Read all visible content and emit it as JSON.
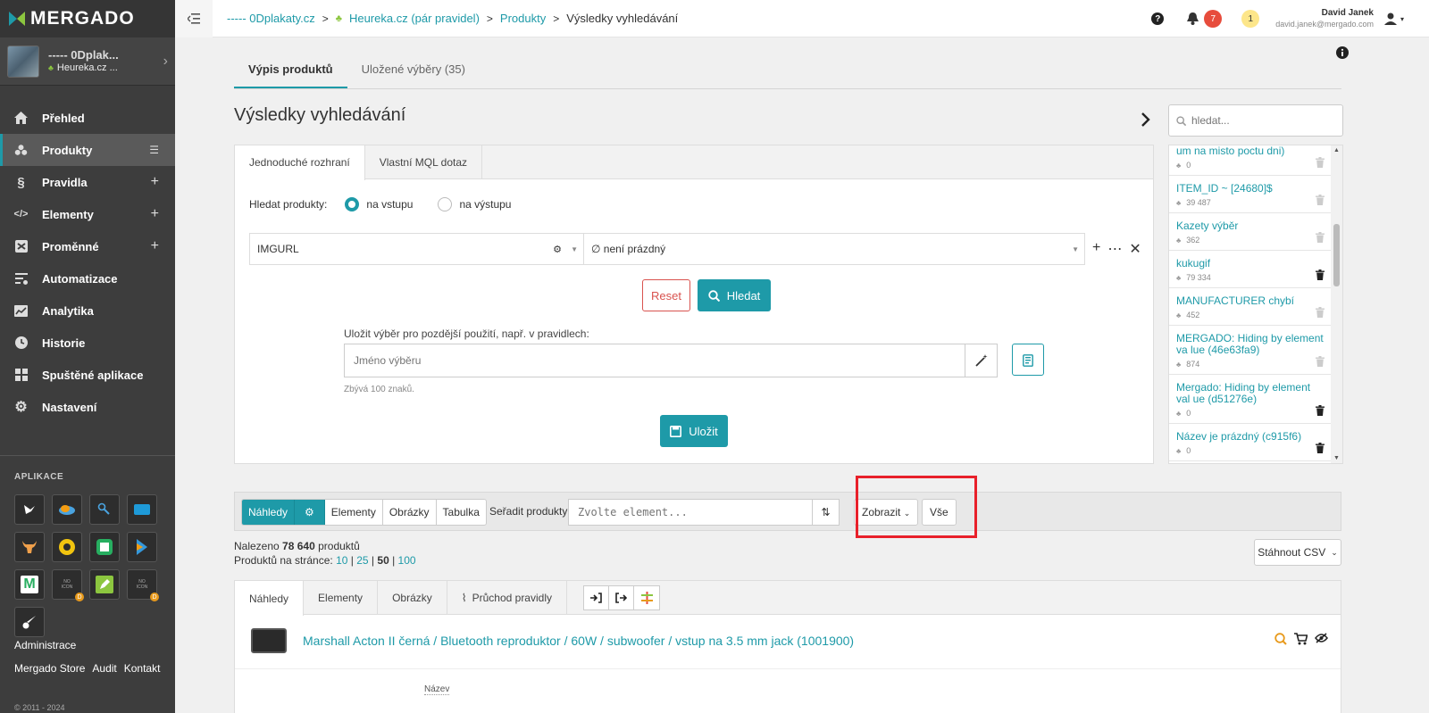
{
  "brand": {
    "name": "MERGADO"
  },
  "project": {
    "name": "----- 0Dplak...",
    "channel": "Heureka.cz ..."
  },
  "nav": [
    {
      "label": "Přehled",
      "icon": "home-icon",
      "right": ""
    },
    {
      "label": "Produkty",
      "icon": "products-icon",
      "right": "list",
      "active": true
    },
    {
      "label": "Pravidla",
      "icon": "section-icon",
      "right": "+"
    },
    {
      "label": "Elementy",
      "icon": "code-icon",
      "right": "+"
    },
    {
      "label": "Proměnné",
      "icon": "variable-icon",
      "right": "+"
    },
    {
      "label": "Automatizace",
      "icon": "automation-icon",
      "right": ""
    },
    {
      "label": "Analytika",
      "icon": "chart-icon",
      "right": ""
    },
    {
      "label": "Historie",
      "icon": "history-icon",
      "right": ""
    },
    {
      "label": "Spuštěné aplikace",
      "icon": "apps-grid-icon",
      "right": ""
    },
    {
      "label": "Nastavení",
      "icon": "gear-icon",
      "right": ""
    }
  ],
  "apps_title": "APLIKACE",
  "side_footer": {
    "admin": "Administrace",
    "store": "Mergado Store",
    "audit": "Audit",
    "contact": "Kontakt",
    "copyright": "© 2011 - 2024"
  },
  "breadcrumb": {
    "project": "----- 0Dplakaty.cz",
    "channel": "Heureka.cz (pár pravidel)",
    "section": "Produkty",
    "current": "Výsledky vyhledávání"
  },
  "topbar": {
    "notif_red": "7",
    "notif_yellow": "1",
    "user_name": "David Janek",
    "user_email": "david.janek@mergado.com"
  },
  "tabs_top": {
    "list": "Výpis produktů",
    "saved": "Uložené výběry (35)"
  },
  "page_title": "Výsledky vyhledávání",
  "search_tabs": {
    "simple": "Jednoduché rozhraní",
    "mql": "Vlastní MQL dotaz"
  },
  "search": {
    "label": "Hledat produkty:",
    "opt_input": "na vstupu",
    "opt_output": "na výstupu",
    "element": "IMGURL",
    "condition": "∅ není prázdný",
    "reset": "Reset",
    "search": "Hledat",
    "save_label": "Uložit výběr pro pozdější použití, např. v pravidlech:",
    "save_placeholder": "Jméno výběru",
    "chars_left": "Zbývá 100 znaků.",
    "save": "Uložit"
  },
  "saved": {
    "placeholder": "hledat...",
    "items": [
      {
        "name": "um na misto poctu dni)",
        "count": "0",
        "trash_dark": false
      },
      {
        "name": "ITEM_ID ~ [24680]$",
        "count": "39 487",
        "trash_dark": false
      },
      {
        "name": "Kazety výběr",
        "count": "362",
        "trash_dark": false
      },
      {
        "name": "kukugif",
        "count": "79 334",
        "trash_dark": true
      },
      {
        "name": "MANUFACTURER chybí",
        "count": "452",
        "trash_dark": false
      },
      {
        "name": "MERGADO: Hiding by element va lue (46e63fa9)",
        "count": "874",
        "trash_dark": false
      },
      {
        "name": "Mergado: Hiding by element val ue (d51276e)",
        "count": "0",
        "trash_dark": true
      },
      {
        "name": "Název je prázdný (c915f6)",
        "count": "0",
        "trash_dark": true
      }
    ]
  },
  "toolbar": {
    "views": [
      "Náhledy",
      "Elementy",
      "Obrázky",
      "Tabulka"
    ],
    "sort_label": "Seřadit produkty",
    "sort_placeholder": "Zvolte element...",
    "show": "Zobrazit",
    "all": "Vše"
  },
  "results": {
    "found_prefix": "Nalezeno",
    "found_count": "78 640",
    "found_suffix": "produktů",
    "per_page_label": "Produktů na stránce:",
    "per_page": [
      "10",
      "25",
      "50",
      "100"
    ],
    "csv": "Stáhnout CSV"
  },
  "product_tabs": [
    "Náhledy",
    "Elementy",
    "Obrázky",
    "Průchod pravidly"
  ],
  "product": {
    "title": "Marshall Acton II černá / Bluetooth reproduktor / 60W / subwoofer / vstup na 3.5 mm jack (1001900)",
    "field_label": "Název"
  },
  "colors": {
    "accent": "#1e9aa8",
    "sidebar": "#3d3d3d",
    "danger": "#d9534f",
    "highlight": "#e8202a"
  }
}
